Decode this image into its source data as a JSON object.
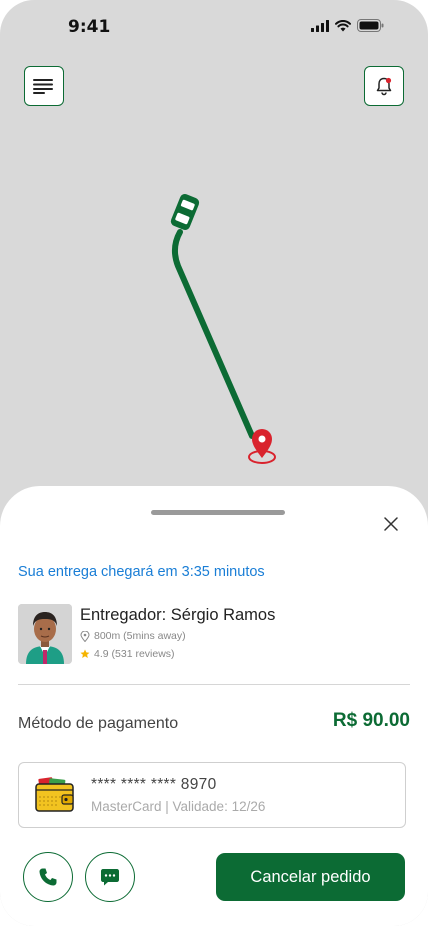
{
  "status_bar": {
    "time": "9:41"
  },
  "map": {
    "menu_icon": "menu-icon",
    "bell_icon": "bell-icon",
    "vehicle_icon": "car-icon",
    "destination_icon": "location-pin-icon",
    "route_color": "#0c6b34",
    "pin_color": "#d9232d"
  },
  "sheet": {
    "eta_text": "Sua entrega chegará em 3:35 minutos",
    "driver": {
      "name": "Entregador: Sérgio Ramos",
      "distance": "800m (5mins away)",
      "rating": "4.9 (531 reviews)"
    },
    "payment": {
      "label": "Método de pagamento",
      "amount": "R$ 90.00",
      "card_number": "**** **** **** 8970",
      "card_details": "MasterCard | Validade: 12/26"
    },
    "actions": {
      "call_icon": "phone-icon",
      "chat_icon": "chat-icon",
      "cancel_label": "Cancelar pedido"
    }
  },
  "colors": {
    "accent": "#0c6b34",
    "link": "#1a7ed6",
    "star": "#f5b400"
  }
}
